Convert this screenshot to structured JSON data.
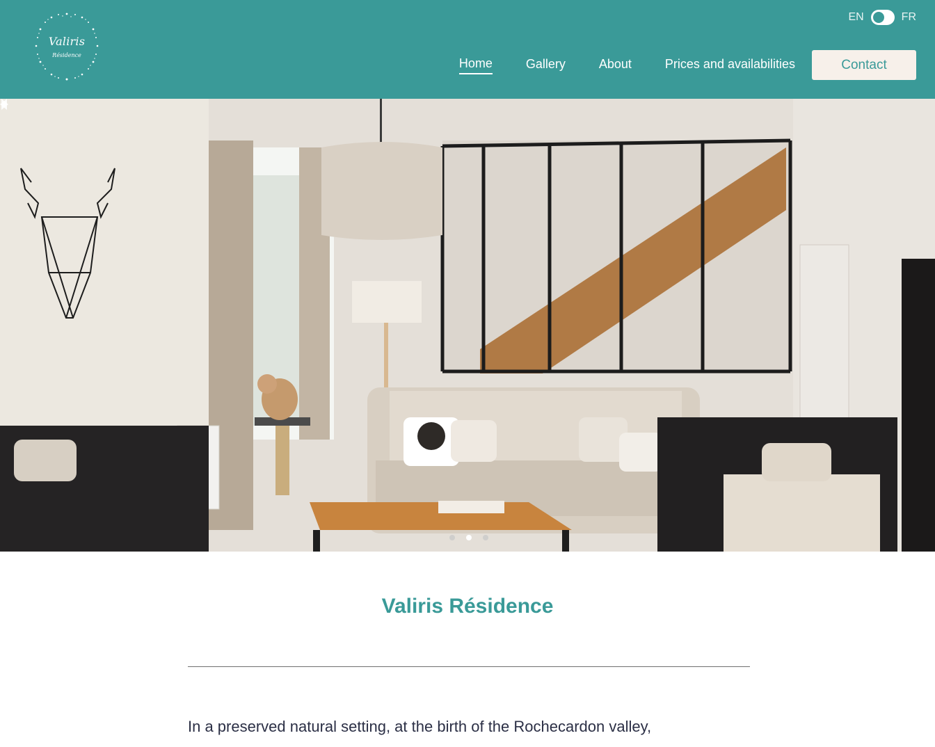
{
  "brand": {
    "logo_title": "Valiris",
    "logo_subtitle": "Résidence"
  },
  "language": {
    "left": "EN",
    "right": "FR",
    "selected": "EN"
  },
  "nav": {
    "items": [
      "Home",
      "Gallery",
      "About",
      "Prices and availabilities"
    ],
    "active": "Home",
    "contact_label": "Contact"
  },
  "slider": {
    "slide_count": 3,
    "active_index": 1
  },
  "content": {
    "title": "Valiris Résidence",
    "intro": "In a preserved natural setting, at the birth of the Rochecardon valley,"
  },
  "colors": {
    "brand": "#3a9a98",
    "button_bg": "#f7f0ea",
    "body_text": "#2b2f45"
  }
}
